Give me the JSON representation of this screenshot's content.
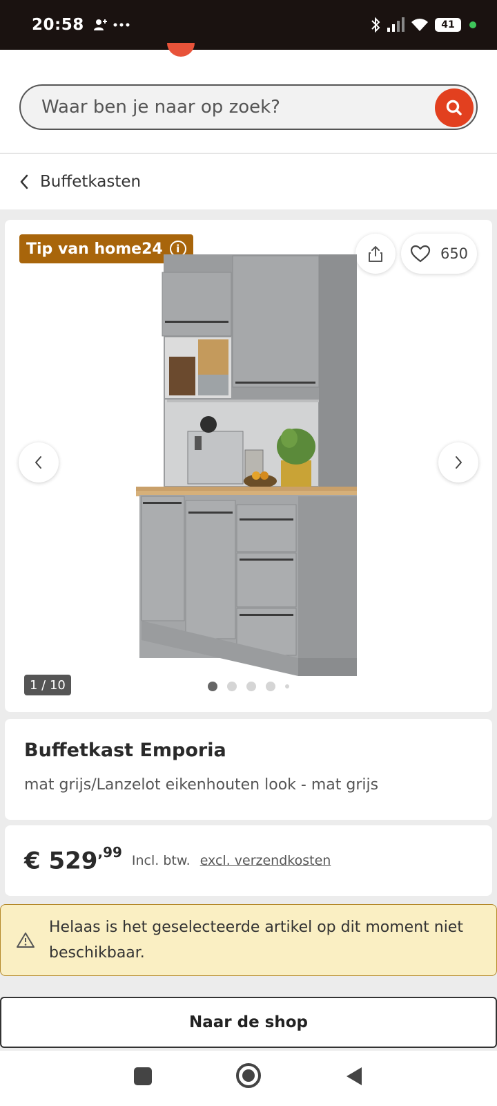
{
  "status_bar": {
    "time": "20:58",
    "notification_icons": [
      "person-add-icon",
      "more-dots-icon"
    ],
    "system_icons": [
      "bluetooth-icon",
      "signal-icon",
      "wifi-icon",
      "battery-icon"
    ],
    "battery_level": "41"
  },
  "header": {
    "search_placeholder": "Waar ben je naar op zoek?",
    "search_icon": "search-icon",
    "accent_color": "#e2401f"
  },
  "breadcrumb": {
    "label": "Buffetkasten",
    "icon": "chevron-left-icon"
  },
  "gallery": {
    "badge": "Tip van home24",
    "badge_color": "#a8650b",
    "favorites_count": "650",
    "counter": "1 / 10",
    "dots_total": 5,
    "active_dot": 0
  },
  "product": {
    "title": "Buffetkast Emporia",
    "variant": "mat grijs/Lanzelot eikenhouten look - mat grijs"
  },
  "price": {
    "currency_main": "€ 529",
    "cents": ",99",
    "tax_note": "Incl. btw.",
    "shipping_link": "excl. verzendkosten"
  },
  "alert": {
    "icon": "warning-icon",
    "text": "Helaas is het geselecteerde artikel op dit moment niet beschikbaar."
  },
  "cta": {
    "label": "Naar de shop"
  }
}
